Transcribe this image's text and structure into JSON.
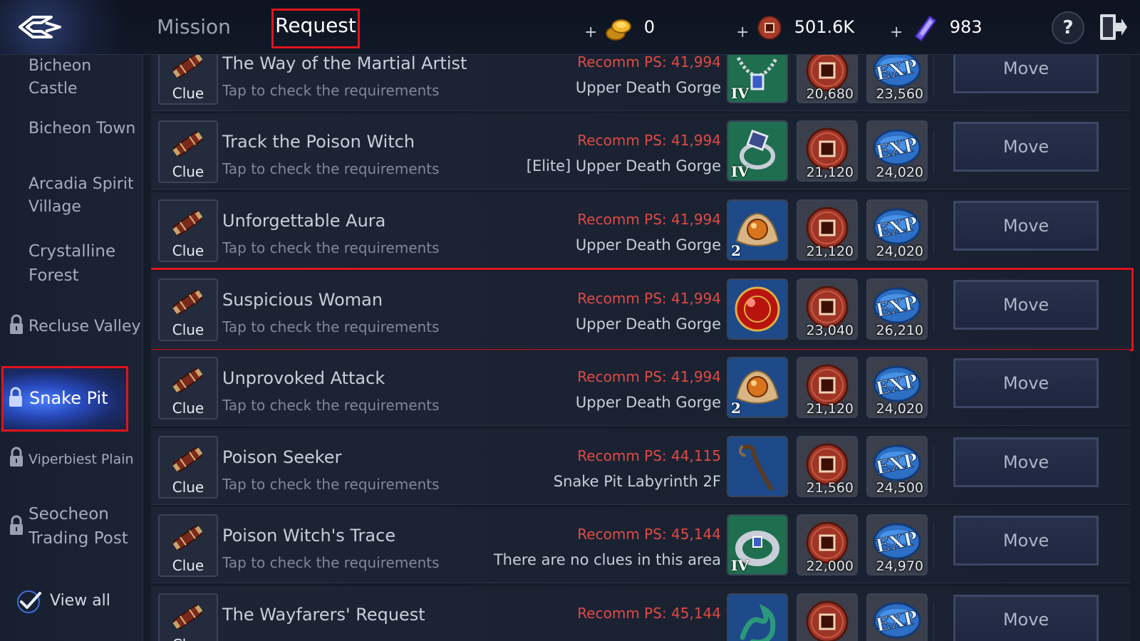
{
  "header": {
    "tabs": [
      {
        "label": "Mission"
      },
      {
        "label": "Request"
      }
    ],
    "currencies": {
      "gold": {
        "plus": "+",
        "value": "0"
      },
      "coin": {
        "plus": "+",
        "value": "501.6K"
      },
      "gem": {
        "plus": "+",
        "value": "983"
      }
    },
    "help_label": "?"
  },
  "sidebar": {
    "items": [
      {
        "label": "Bicheon Castle",
        "locked": false
      },
      {
        "label": "Bicheon Town",
        "locked": false
      },
      {
        "label": "Arcadia Spirit Village",
        "locked": false
      },
      {
        "label": "Crystalline Forest",
        "locked": false
      },
      {
        "label": "Recluse Valley",
        "locked": true
      },
      {
        "label": "Snake Pit",
        "locked": true,
        "selected": true
      },
      {
        "label": "Viperbiest Plain",
        "locked": true
      },
      {
        "label": "Seocheon Trading Post",
        "locked": true
      }
    ],
    "view_all_label": "View all"
  },
  "quests": [
    {
      "title": "The Way of the Martial Artist",
      "subtitle": "Tap to check the requirements",
      "ps": "Recomm PS: 41,994",
      "location": "Upper Death Gorge",
      "item": "necklace-icon",
      "item_label": "IV",
      "coin": "20,680",
      "exp": "23,560",
      "move": "Move",
      "clue": "Clue"
    },
    {
      "title": "Track the Poison Witch",
      "subtitle": "Tap to check the requirements",
      "ps": "Recomm PS: 41,994",
      "location": "[Elite] Upper Death Gorge",
      "item": "ring-icon",
      "item_label": "IV",
      "coin": "21,120",
      "exp": "24,020",
      "move": "Move",
      "clue": "Clue"
    },
    {
      "title": "Unforgettable Aura",
      "subtitle": "Tap to check the requirements",
      "ps": "Recomm PS: 41,994",
      "location": "Upper Death Gorge",
      "item": "orb-pouch-icon",
      "item_label": "2",
      "coin": "21,120",
      "exp": "24,020",
      "move": "Move",
      "clue": "Clue"
    },
    {
      "title": "Suspicious Woman",
      "subtitle": "Tap to check the requirements",
      "ps": "Recomm PS: 41,994",
      "location": "Upper Death Gorge",
      "item": "red-orb-icon",
      "item_label": "",
      "coin": "23,040",
      "exp": "26,210",
      "move": "Move",
      "clue": "Clue"
    },
    {
      "title": "Unprovoked Attack",
      "subtitle": "Tap to check the requirements",
      "ps": "Recomm PS: 41,994",
      "location": "Upper Death Gorge",
      "item": "orb-pouch-icon",
      "item_label": "2",
      "coin": "21,120",
      "exp": "24,020",
      "move": "Move",
      "clue": "Clue"
    },
    {
      "title": "Poison Seeker",
      "subtitle": "Tap to check the requirements",
      "ps": "Recomm PS: 44,115",
      "location": "Snake Pit Labyrinth 2F",
      "item": "staff-icon",
      "item_label": "",
      "coin": "21,560",
      "exp": "24,500",
      "move": "Move",
      "clue": "Clue"
    },
    {
      "title": "Poison Witch's Trace",
      "subtitle": "Tap to check the requirements",
      "ps": "Recomm PS: 45,144",
      "location": "There are no clues in this area",
      "item": "bracelet-icon",
      "item_label": "IV",
      "coin": "22,000",
      "exp": "24,970",
      "move": "Move",
      "clue": "Clue"
    },
    {
      "title": "The Wayfarers' Request",
      "subtitle": "",
      "ps": "Recomm PS: 45,144",
      "location": "",
      "item": "dragon-icon",
      "item_label": "",
      "coin": "",
      "exp": "",
      "move": "Move",
      "clue": "Clue"
    }
  ],
  "colors": {
    "highlight": "#e0141c",
    "ps_text": "#e04a44",
    "selected_bg": "#2748b8"
  }
}
